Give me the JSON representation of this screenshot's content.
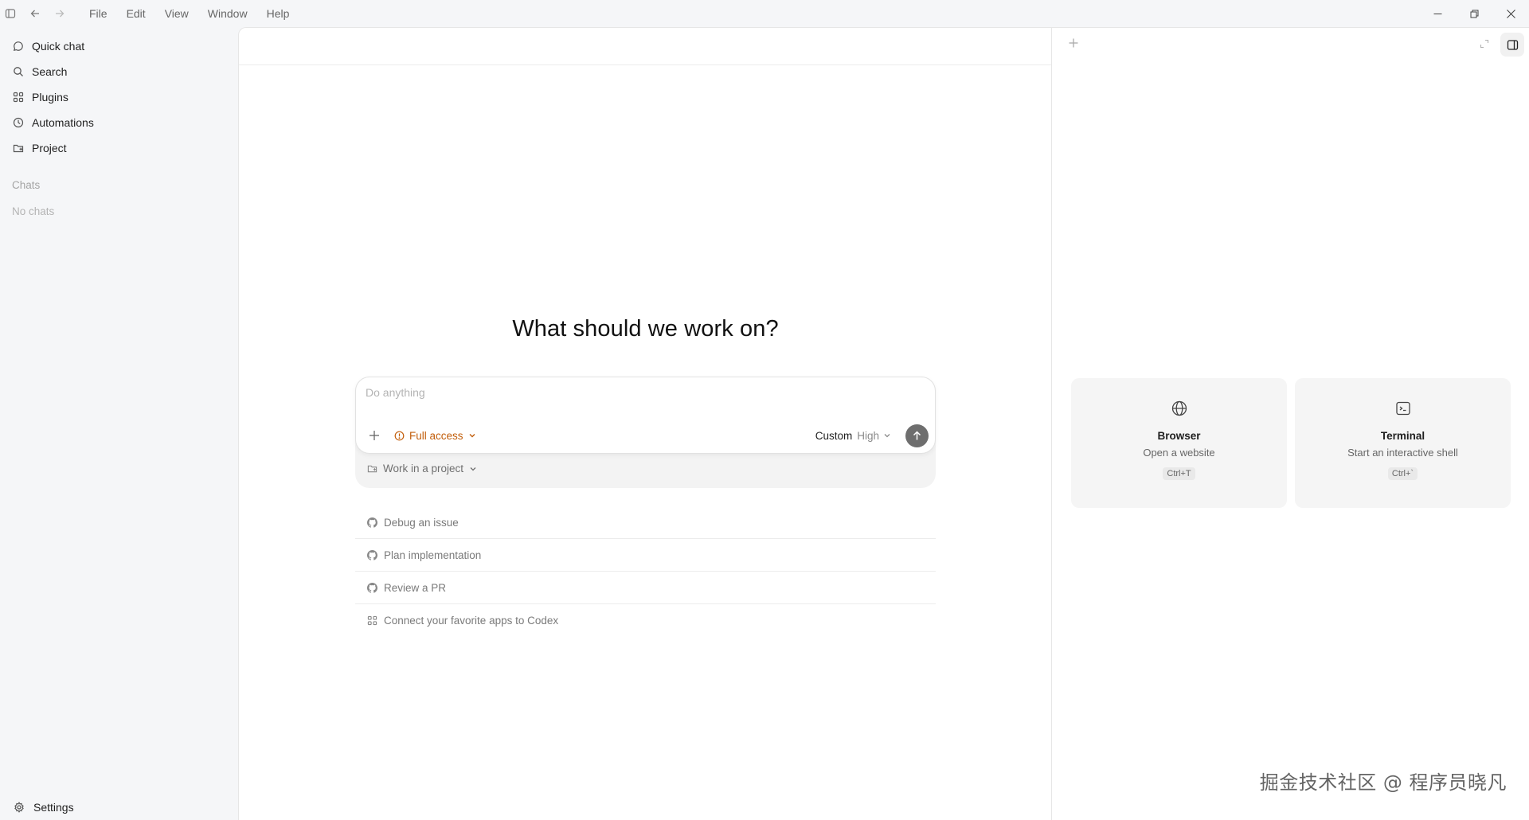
{
  "menu": [
    "File",
    "Edit",
    "View",
    "Window",
    "Help"
  ],
  "sidebar": {
    "items": [
      {
        "label": "Quick chat",
        "icon": "chat-bubble-icon"
      },
      {
        "label": "Search",
        "icon": "search-icon"
      },
      {
        "label": "Plugins",
        "icon": "grid-icon"
      },
      {
        "label": "Automations",
        "icon": "clock-icon"
      },
      {
        "label": "Project",
        "icon": "folder-icon"
      }
    ],
    "chats_label": "Chats",
    "empty_chats": "No chats",
    "settings_label": "Settings"
  },
  "main": {
    "heading": "What should we work on?",
    "composer": {
      "placeholder": "Do anything",
      "access_label": "Full access",
      "model_label": "Custom",
      "effort_label": "High"
    },
    "project_label": "Work in a project",
    "suggestions": [
      {
        "label": "Debug an issue",
        "icon": "github-icon"
      },
      {
        "label": "Plan implementation",
        "icon": "github-icon"
      },
      {
        "label": "Review a PR",
        "icon": "github-icon"
      },
      {
        "label": "Connect your favorite apps to Codex",
        "icon": "grid-icon"
      }
    ]
  },
  "right_panel": {
    "cards": [
      {
        "title": "Browser",
        "desc": "Open a website",
        "shortcut": "Ctrl+T",
        "icon": "globe-icon"
      },
      {
        "title": "Terminal",
        "desc": "Start an interactive shell",
        "shortcut": "Ctrl+`",
        "icon": "terminal-icon"
      }
    ]
  },
  "watermark": "掘金技术社区 @ 程序员晓凡",
  "colors": {
    "accent_orange": "#c25e0b",
    "send_button": "#6e6e6e",
    "sidebar_bg": "#f5f6f8"
  }
}
